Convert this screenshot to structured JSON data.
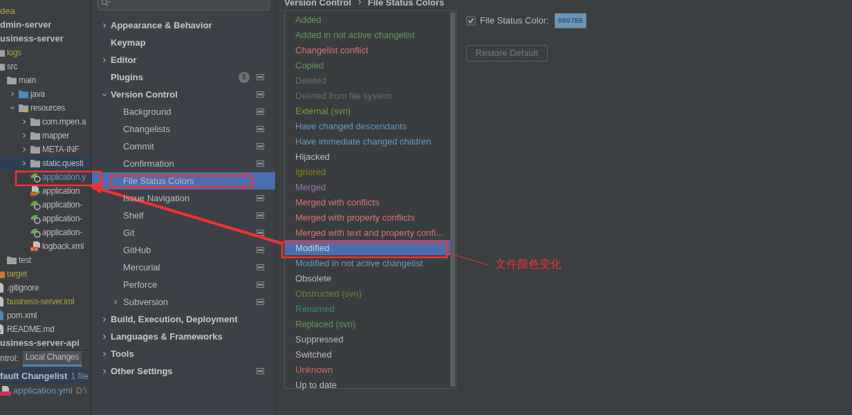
{
  "project_tree": [
    {
      "label": "dea",
      "kind": "clipped",
      "color": "#a8a33a",
      "selected": false
    },
    {
      "label": "dmin-server",
      "kind": "module",
      "selected": false
    },
    {
      "label": "usiness-server",
      "kind": "module",
      "selected": false,
      "children": [
        {
          "label": "logs",
          "kind": "folder",
          "color": "#a8a33a",
          "selected": false
        },
        {
          "label": "src",
          "kind": "folder",
          "selected": false,
          "children": [
            {
              "label": "main",
              "kind": "folder",
              "selected": false,
              "children": [
                {
                  "label": "java",
                  "kind": "source-folder",
                  "expanded": false,
                  "selected": false
                },
                {
                  "label": "resources",
                  "kind": "resource-folder",
                  "expanded": true,
                  "selected": false,
                  "children": [
                    {
                      "label": "com.mpen.a",
                      "kind": "folder",
                      "expanded": false,
                      "selected": false
                    },
                    {
                      "label": "mapper",
                      "kind": "folder",
                      "expanded": false,
                      "selected": false
                    },
                    {
                      "label": "META-INF",
                      "kind": "folder",
                      "expanded": false,
                      "selected": false
                    },
                    {
                      "label": "static.questi",
                      "kind": "folder",
                      "expanded": false,
                      "selected": true
                    },
                    {
                      "label": "application.y",
                      "kind": "config-file",
                      "color": "#6897bb",
                      "selected": false
                    },
                    {
                      "label": "application",
                      "kind": "xml-config-file",
                      "selected": false
                    },
                    {
                      "label": "application-",
                      "kind": "config-file",
                      "selected": false
                    },
                    {
                      "label": "application-",
                      "kind": "config-file",
                      "selected": false
                    },
                    {
                      "label": "application-",
                      "kind": "config-file",
                      "selected": false
                    },
                    {
                      "label": "logback.xml",
                      "kind": "xml-file",
                      "selected": false
                    }
                  ]
                }
              ]
            },
            {
              "label": "test",
              "kind": "folder",
              "selected": false
            }
          ]
        },
        {
          "label": "target",
          "kind": "excluded-folder",
          "color": "#a8a33a",
          "selected": false
        },
        {
          "label": ".gitignore",
          "kind": "text-file",
          "selected": false
        },
        {
          "label": "business-server.iml",
          "kind": "text-file",
          "color": "#a8a33a",
          "selected": false
        },
        {
          "label": "pom.xml",
          "kind": "maven-file",
          "selected": false
        },
        {
          "label": "README.md",
          "kind": "markdown-file",
          "selected": false
        }
      ]
    },
    {
      "label": "usiness-server-api",
      "kind": "module",
      "selected": false
    }
  ],
  "bottom_panel": {
    "title": "ntrol:",
    "tabs": [
      {
        "label": "Local Changes",
        "selected": true
      }
    ],
    "changelist": {
      "name": "fault Changelist",
      "count": "1 file",
      "files": [
        {
          "name": "application.yml",
          "path": "D:\\"
        }
      ]
    }
  },
  "settings_sidebar": [
    {
      "label": "Appearance & Behavior",
      "expanded": false,
      "selected": false,
      "project_level": false
    },
    {
      "label": "Keymap",
      "selected": false,
      "project_level": false
    },
    {
      "label": "Editor",
      "expanded": false,
      "selected": false,
      "project_level": false
    },
    {
      "label": "Plugins",
      "badge": "5",
      "selected": false,
      "project_level": true
    },
    {
      "label": "Version Control",
      "expanded": true,
      "selected": false,
      "project_level": true,
      "children": [
        {
          "label": "Background",
          "selected": false,
          "project_level": true
        },
        {
          "label": "Changelists",
          "selected": false,
          "project_level": true
        },
        {
          "label": "Commit",
          "selected": false,
          "project_level": true
        },
        {
          "label": "Confirmation",
          "selected": false,
          "project_level": true
        },
        {
          "label": "File Status Colors",
          "selected": true,
          "project_level": false
        },
        {
          "label": "Issue Navigation",
          "selected": false,
          "project_level": true
        },
        {
          "label": "Shelf",
          "selected": false,
          "project_level": true
        },
        {
          "label": "Git",
          "selected": false,
          "project_level": true
        },
        {
          "label": "GitHub",
          "selected": false,
          "project_level": true
        },
        {
          "label": "Mercurial",
          "selected": false,
          "project_level": true
        },
        {
          "label": "Perforce",
          "selected": false,
          "project_level": true
        },
        {
          "label": "Subversion",
          "expanded": false,
          "selected": false,
          "project_level": true
        }
      ]
    },
    {
      "label": "Build, Execution, Deployment",
      "expanded": false,
      "selected": false,
      "project_level": false
    },
    {
      "label": "Languages & Frameworks",
      "expanded": false,
      "selected": false,
      "project_level": false
    },
    {
      "label": "Tools",
      "expanded": false,
      "selected": false,
      "project_level": false
    },
    {
      "label": "Other Settings",
      "expanded": false,
      "selected": false,
      "project_level": true
    }
  ],
  "breadcrumb": [
    "Version Control",
    "File Status Colors"
  ],
  "statuses": [
    {
      "label": "Added",
      "color": "#629755",
      "selected": false
    },
    {
      "label": "Added in not active changelist",
      "color": "#629755",
      "selected": false
    },
    {
      "label": "Changelist conflict",
      "color": "#d5756c",
      "selected": false
    },
    {
      "label": "Copied",
      "color": "#629755",
      "selected": false
    },
    {
      "label": "Deleted",
      "color": "#6c6c6c",
      "selected": false
    },
    {
      "label": "Deleted from file system",
      "color": "#6c6c6c",
      "selected": false
    },
    {
      "label": "External (svn)",
      "color": "#72a02a",
      "selected": false
    },
    {
      "label": "Have changed descendants",
      "color": "#6897bb",
      "selected": false
    },
    {
      "label": "Have immediate changed children",
      "color": "#6897bb",
      "selected": false
    },
    {
      "label": "Hijacked",
      "color": "#bbbbbb",
      "selected": false
    },
    {
      "label": "Ignored",
      "color": "#848504",
      "selected": false
    },
    {
      "label": "Merged",
      "color": "#9876aa",
      "selected": false
    },
    {
      "label": "Merged with conflicts",
      "color": "#d5756c",
      "selected": false
    },
    {
      "label": "Merged with property conflicts",
      "color": "#d5756c",
      "selected": false
    },
    {
      "label": "Merged with text and property confl...",
      "color": "#d5756c",
      "selected": false
    },
    {
      "label": "Modified",
      "color": "#c5d0de",
      "selected": true
    },
    {
      "label": "Modified in not active changelist",
      "color": "#6897bb",
      "selected": false
    },
    {
      "label": "Obsolete",
      "color": "#bbbbbb",
      "selected": false
    },
    {
      "label": "Obstructed (svn)",
      "color": "#717f3a",
      "selected": false
    },
    {
      "label": "Renamed",
      "color": "#3a8484",
      "selected": false
    },
    {
      "label": "Replaced (svn)",
      "color": "#629755",
      "selected": false
    },
    {
      "label": "Suppressed",
      "color": "#bbbbbb",
      "selected": false
    },
    {
      "label": "Switched",
      "color": "#bbbbbb",
      "selected": false
    },
    {
      "label": "Unknown",
      "color": "#d1675a",
      "selected": false
    },
    {
      "label": "Up to date",
      "color": "#bbbbbb",
      "selected": false
    }
  ],
  "file_status_color": {
    "label": "File Status Color:",
    "checked": true,
    "value": "6897BB",
    "color": "#6897bb"
  },
  "restore_button": {
    "label": "Restore Default",
    "disabled": true
  },
  "annotation": {
    "note": "文件颜色变化"
  }
}
